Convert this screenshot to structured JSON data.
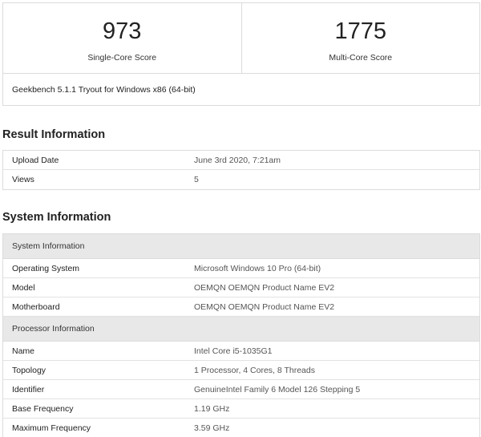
{
  "scores": {
    "single_core_value": "973",
    "single_core_label": "Single-Core Score",
    "multi_core_value": "1775",
    "multi_core_label": "Multi-Core Score",
    "version": "Geekbench 5.1.1 Tryout for Windows x86 (64-bit)"
  },
  "result_information": {
    "title": "Result Information",
    "rows": [
      {
        "key": "Upload Date",
        "value": "June 3rd 2020, 7:21am"
      },
      {
        "key": "Views",
        "value": "5"
      }
    ]
  },
  "system_information": {
    "title": "System Information",
    "groups": [
      {
        "heading": "System Information",
        "rows": [
          {
            "key": "Operating System",
            "value": "Microsoft Windows 10 Pro (64-bit)"
          },
          {
            "key": "Model",
            "value": "OEMQN OEMQN Product Name EV2"
          },
          {
            "key": "Motherboard",
            "value": "OEMQN OEMQN Product Name EV2"
          }
        ]
      },
      {
        "heading": "Processor Information",
        "rows": [
          {
            "key": "Name",
            "value": "Intel Core i5-1035G1"
          },
          {
            "key": "Topology",
            "value": "1 Processor, 4 Cores, 8 Threads"
          },
          {
            "key": "Identifier",
            "value": "GenuineIntel Family 6 Model 126 Stepping 5"
          },
          {
            "key": "Base Frequency",
            "value": "1.19 GHz"
          },
          {
            "key": "Maximum Frequency",
            "value": "3.59 GHz"
          }
        ]
      }
    ]
  }
}
